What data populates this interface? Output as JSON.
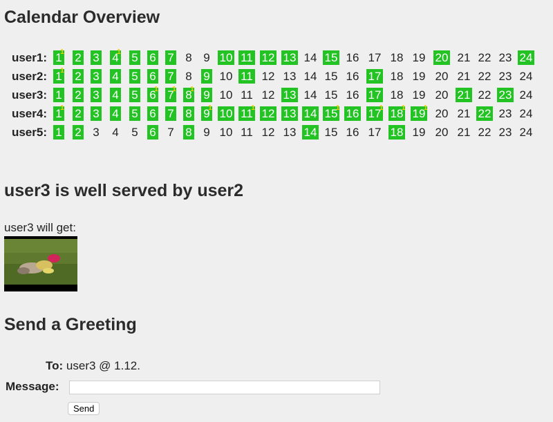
{
  "calendar": {
    "title": "Calendar Overview",
    "colors": {
      "available": "#22c322",
      "marker": "#f0d000"
    },
    "rows": [
      {
        "label": "user1:",
        "days": [
          {
            "n": "1",
            "on": true,
            "sup": "1"
          },
          {
            "n": "2",
            "on": true
          },
          {
            "n": "3",
            "on": true
          },
          {
            "n": "4",
            "on": true,
            "sup": "1"
          },
          {
            "n": "5",
            "on": true
          },
          {
            "n": "6",
            "on": true
          },
          {
            "n": "7",
            "on": true
          },
          {
            "n": "8"
          },
          {
            "n": "9"
          },
          {
            "n": "10",
            "on": true
          },
          {
            "n": "11",
            "on": true
          },
          {
            "n": "12",
            "on": true
          },
          {
            "n": "13",
            "on": true
          },
          {
            "n": "14"
          },
          {
            "n": "15",
            "on": true
          },
          {
            "n": "16"
          },
          {
            "n": "17"
          },
          {
            "n": "18"
          },
          {
            "n": "19"
          },
          {
            "n": "20",
            "on": true
          },
          {
            "n": "21"
          },
          {
            "n": "22"
          },
          {
            "n": "23"
          },
          {
            "n": "24",
            "on": true
          }
        ]
      },
      {
        "label": "user2:",
        "days": [
          {
            "n": "1",
            "on": true,
            "sup": "1"
          },
          {
            "n": "2",
            "on": true
          },
          {
            "n": "3",
            "on": true
          },
          {
            "n": "4",
            "on": true
          },
          {
            "n": "5",
            "on": true
          },
          {
            "n": "6",
            "on": true
          },
          {
            "n": "7",
            "on": true
          },
          {
            "n": "8"
          },
          {
            "n": "9",
            "on": true
          },
          {
            "n": "10"
          },
          {
            "n": "11",
            "on": true
          },
          {
            "n": "12"
          },
          {
            "n": "13"
          },
          {
            "n": "14"
          },
          {
            "n": "15"
          },
          {
            "n": "16"
          },
          {
            "n": "17",
            "on": true
          },
          {
            "n": "18"
          },
          {
            "n": "19"
          },
          {
            "n": "20"
          },
          {
            "n": "21"
          },
          {
            "n": "22"
          },
          {
            "n": "23"
          },
          {
            "n": "24"
          }
        ]
      },
      {
        "label": "user3:",
        "days": [
          {
            "n": "1",
            "on": true
          },
          {
            "n": "2",
            "on": true
          },
          {
            "n": "3",
            "on": true
          },
          {
            "n": "4",
            "on": true
          },
          {
            "n": "5",
            "on": true
          },
          {
            "n": "6",
            "on": true,
            "sup": "1"
          },
          {
            "n": "7",
            "on": true,
            "sup": "1"
          },
          {
            "n": "8",
            "on": true,
            "sup": "1"
          },
          {
            "n": "9",
            "on": true
          },
          {
            "n": "10"
          },
          {
            "n": "11"
          },
          {
            "n": "12"
          },
          {
            "n": "13",
            "on": true
          },
          {
            "n": "14"
          },
          {
            "n": "15"
          },
          {
            "n": "16"
          },
          {
            "n": "17",
            "on": true
          },
          {
            "n": "18"
          },
          {
            "n": "19"
          },
          {
            "n": "20"
          },
          {
            "n": "21",
            "on": true
          },
          {
            "n": "22"
          },
          {
            "n": "23",
            "on": true
          },
          {
            "n": "24"
          }
        ]
      },
      {
        "label": "user4:",
        "days": [
          {
            "n": "1",
            "on": true,
            "sup": "1"
          },
          {
            "n": "2",
            "on": true
          },
          {
            "n": "3",
            "on": true
          },
          {
            "n": "4",
            "on": true
          },
          {
            "n": "5",
            "on": true
          },
          {
            "n": "6",
            "on": true
          },
          {
            "n": "7",
            "on": true
          },
          {
            "n": "8",
            "on": true
          },
          {
            "n": "9",
            "on": true,
            "sup": "1"
          },
          {
            "n": "10",
            "on": true
          },
          {
            "n": "11",
            "on": true,
            "sup": "1"
          },
          {
            "n": "12",
            "on": true
          },
          {
            "n": "13",
            "on": true
          },
          {
            "n": "14",
            "on": true
          },
          {
            "n": "15",
            "on": true,
            "sup": "1"
          },
          {
            "n": "16",
            "on": true
          },
          {
            "n": "17",
            "on": true,
            "sup": "1"
          },
          {
            "n": "18",
            "on": true,
            "sup": "1"
          },
          {
            "n": "19",
            "on": true,
            "sup": "1"
          },
          {
            "n": "20"
          },
          {
            "n": "21"
          },
          {
            "n": "22",
            "on": true
          },
          {
            "n": "23"
          },
          {
            "n": "24"
          }
        ]
      },
      {
        "label": "user5:",
        "days": [
          {
            "n": "1",
            "on": true
          },
          {
            "n": "2",
            "on": true
          },
          {
            "n": "3"
          },
          {
            "n": "4"
          },
          {
            "n": "5"
          },
          {
            "n": "6",
            "on": true
          },
          {
            "n": "7"
          },
          {
            "n": "8",
            "on": true
          },
          {
            "n": "9"
          },
          {
            "n": "10"
          },
          {
            "n": "11"
          },
          {
            "n": "12"
          },
          {
            "n": "13"
          },
          {
            "n": "14",
            "on": true
          },
          {
            "n": "15"
          },
          {
            "n": "16"
          },
          {
            "n": "17"
          },
          {
            "n": "18",
            "on": true
          },
          {
            "n": "19"
          },
          {
            "n": "20"
          },
          {
            "n": "21"
          },
          {
            "n": "22"
          },
          {
            "n": "23"
          },
          {
            "n": "24"
          }
        ]
      }
    ]
  },
  "served": {
    "title": "user3 is well served by user2",
    "will_get": "user3 will get:",
    "thumbnail_icon": "video-thumbnail-image"
  },
  "greeting": {
    "title": "Send a Greeting",
    "to_label": "To:",
    "to_value": "user3 @ 1.12.",
    "message_label": "Message:",
    "message_value": "",
    "message_placeholder": "",
    "send_label": "Send"
  }
}
